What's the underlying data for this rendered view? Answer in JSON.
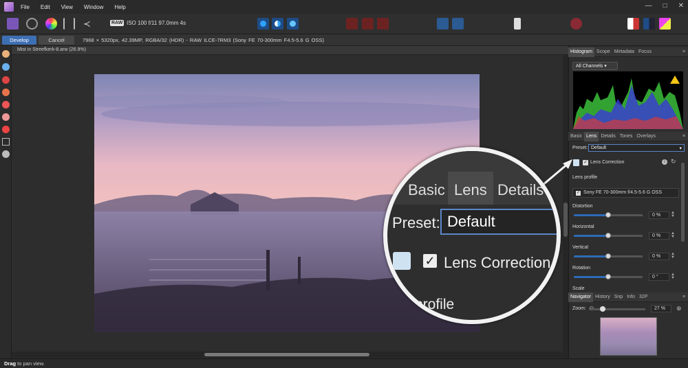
{
  "menu": {
    "items": [
      "File",
      "Edit",
      "View",
      "Window",
      "Help"
    ]
  },
  "toolbar": {
    "raw_badge": "RAW",
    "exposure": "ISO 100 f/11 97.0mm 4s"
  },
  "context": {
    "develop_label": "Develop",
    "cancel_label": "Cancel",
    "info": "7968 × 5320px, 42.39MP, RGBA/32 (HDR) - RAW    ILCE-7RM3 (Sony FE 70-300mm F4.5-5.6 G OSS)"
  },
  "document": {
    "tab_title": "Mist in Streefkerk-8.arw (26.9%)"
  },
  "status": {
    "bold": "Drag",
    "text": " to pan view."
  },
  "histogram_panel": {
    "tabs": [
      "Histogram",
      "Scope",
      "Metadata",
      "Focus"
    ],
    "active": "Histogram",
    "channels": "All Channels"
  },
  "develop_panel": {
    "tabs": [
      "Basic",
      "Lens",
      "Details",
      "Tones",
      "Overlays"
    ],
    "active": "Lens",
    "preset_label": "Preset:",
    "preset_value": "Default",
    "lens_correction_label": "Lens Correction",
    "lens_profile_heading": "Lens profile",
    "lens_profile_value": "Sony FE 70-300mm f/4.5-5.6 G OSS",
    "sliders": [
      {
        "label": "Distortion",
        "value": "0 %",
        "level": 0.5
      },
      {
        "label": "Horizontal",
        "value": "0 %",
        "level": 0.5
      },
      {
        "label": "Vertical",
        "value": "0 %",
        "level": 0.5
      },
      {
        "label": "Rotation",
        "value": "0 °",
        "level": 0.5
      }
    ],
    "scale_label": "Scale"
  },
  "navigator_panel": {
    "tabs": [
      "Navigator",
      "History",
      "Snp",
      "Info",
      "32P"
    ],
    "active": "Navigator",
    "zoom_label": "Zoom:",
    "zoom_value": "27 %"
  },
  "magnifier": {
    "tabs": [
      "Basic",
      "Lens",
      "Details"
    ],
    "preset_label": "Preset:",
    "preset_value": "Default",
    "lens_correction_label": "Lens Correction",
    "profile_text": "profile"
  },
  "colors": {
    "accent": "#3d6fb5",
    "selection_border": "#5b87c9"
  }
}
